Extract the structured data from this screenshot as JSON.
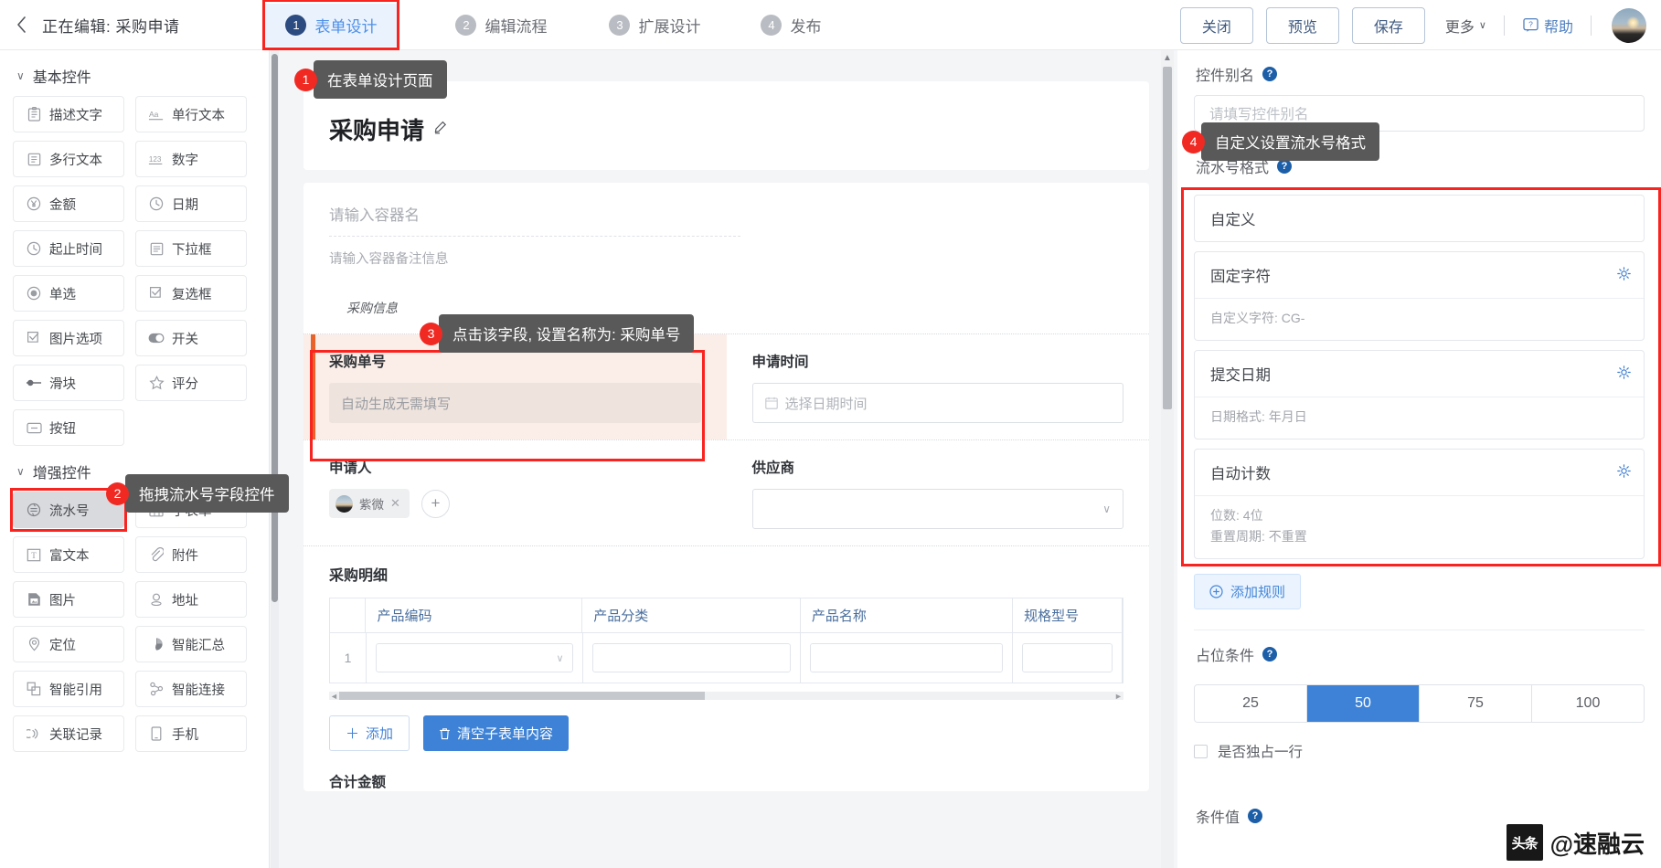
{
  "topbar": {
    "back_icon": "chevron-left-icon",
    "editing_label": "正在编辑: 采购申请",
    "steps": [
      {
        "num": "1",
        "label": "表单设计"
      },
      {
        "num": "2",
        "label": "编辑流程"
      },
      {
        "num": "3",
        "label": "扩展设计"
      },
      {
        "num": "4",
        "label": "发布"
      }
    ],
    "close_label": "关闭",
    "preview_label": "预览",
    "save_label": "保存",
    "more_label": "更多",
    "more_caret": "∨",
    "help_label": "帮助"
  },
  "left_panel": {
    "groups": [
      {
        "title": "基本控件",
        "caret": "∨",
        "items": [
          {
            "label": "描述文字",
            "icon": "description-text-icon"
          },
          {
            "label": "单行文本",
            "icon": "single-line-text-icon"
          },
          {
            "label": "多行文本",
            "icon": "multi-line-text-icon"
          },
          {
            "label": "数字",
            "icon": "number-icon"
          },
          {
            "label": "金额",
            "icon": "currency-icon"
          },
          {
            "label": "日期",
            "icon": "date-icon"
          },
          {
            "label": "起止时间",
            "icon": "time-range-icon"
          },
          {
            "label": "下拉框",
            "icon": "dropdown-icon"
          },
          {
            "label": "单选",
            "icon": "radio-icon"
          },
          {
            "label": "复选框",
            "icon": "checkbox-icon"
          },
          {
            "label": "图片选项",
            "icon": "image-option-icon"
          },
          {
            "label": "开关",
            "icon": "switch-icon"
          },
          {
            "label": "滑块",
            "icon": "slider-icon"
          },
          {
            "label": "评分",
            "icon": "star-rating-icon"
          },
          {
            "label": "按钮",
            "icon": "button-icon"
          }
        ]
      },
      {
        "title": "增强控件",
        "caret": "∨",
        "items": [
          {
            "label": "流水号",
            "icon": "serial-number-icon",
            "selected": true,
            "highlighted": true
          },
          {
            "label": "子表单",
            "icon": "subform-table-icon"
          },
          {
            "label": "富文本",
            "icon": "rich-text-icon"
          },
          {
            "label": "附件",
            "icon": "attachment-icon"
          },
          {
            "label": "图片",
            "icon": "image-icon"
          },
          {
            "label": "地址",
            "icon": "address-icon"
          },
          {
            "label": "定位",
            "icon": "location-pin-icon"
          },
          {
            "label": "智能汇总",
            "icon": "smart-summary-icon"
          },
          {
            "label": "智能引用",
            "icon": "smart-reference-icon"
          },
          {
            "label": "智能连接",
            "icon": "smart-connect-icon"
          },
          {
            "label": "关联记录",
            "icon": "linked-record-icon"
          },
          {
            "label": "手机",
            "icon": "mobile-phone-icon"
          }
        ]
      }
    ]
  },
  "canvas": {
    "form_title": "采购申请",
    "edit_icon": "pencil-icon",
    "container_name_placeholder": "请输入容器名",
    "container_remark_placeholder": "请输入容器备注信息",
    "section_label": "采购信息",
    "fields": {
      "order_no_label": "采购单号",
      "order_no_value": "自动生成无需填写",
      "apply_time_label": "申请时间",
      "apply_time_placeholder": "选择日期时间",
      "apply_time_icon": "calendar-icon",
      "applicant_label": "申请人",
      "applicant_name": "紫微",
      "applicant_remove": "✕",
      "applicant_add": "+",
      "supplier_label": "供应商",
      "supplier_value": "",
      "supplier_caret": "∨"
    },
    "subform": {
      "title": "采购明细",
      "columns": [
        "产品编码",
        "产品分类",
        "产品名称",
        "规格型号"
      ],
      "rows": [
        {
          "index": "1",
          "cells": [
            "",
            "",
            "",
            ""
          ]
        }
      ],
      "add_label": "添加",
      "add_icon": "plus-icon",
      "clear_label": "清空子表单内容",
      "clear_icon": "trash-icon"
    },
    "total_label": "合计金额"
  },
  "right_panel": {
    "alias_label": "控件别名",
    "alias_placeholder": "请填写控件别名",
    "format_label": "流水号格式",
    "rules": [
      {
        "title": "自定义",
        "sub": []
      },
      {
        "title": "固定字符",
        "sub": [
          "自定义字符: CG-"
        ],
        "gear": "gear-icon"
      },
      {
        "title": "提交日期",
        "sub": [
          "日期格式: 年月日"
        ],
        "gear": "gear-icon"
      },
      {
        "title": "自动计数",
        "sub": [
          "位数: 4位",
          "重置周期: 不重置"
        ],
        "gear": "gear-icon"
      }
    ],
    "add_rule_label": "添加规则",
    "add_rule_icon": "plus-circle-icon",
    "placeholder_label": "占位条件",
    "width_options": [
      "25",
      "50",
      "75",
      "100"
    ],
    "width_selected": "50",
    "exclusive_row_label": "是否独占一行",
    "bottom_label": "条件值"
  },
  "callouts": [
    {
      "num": "1",
      "text": "在表单设计页面"
    },
    {
      "num": "2",
      "text": "拖拽流水号字段控件"
    },
    {
      "num": "3",
      "text": "点击该字段, 设置名称为: 采购单号"
    },
    {
      "num": "4",
      "text": "自定义设置流水号格式"
    }
  ],
  "watermark": {
    "logo": "头条",
    "text": "@速融云"
  },
  "colors": {
    "accent_blue": "#3d82d6",
    "step_active": "#4d90e8",
    "highlight_red": "#f9231f",
    "selected_field_bg": "#fbeee9",
    "selected_field_bar": "#e8622a"
  }
}
